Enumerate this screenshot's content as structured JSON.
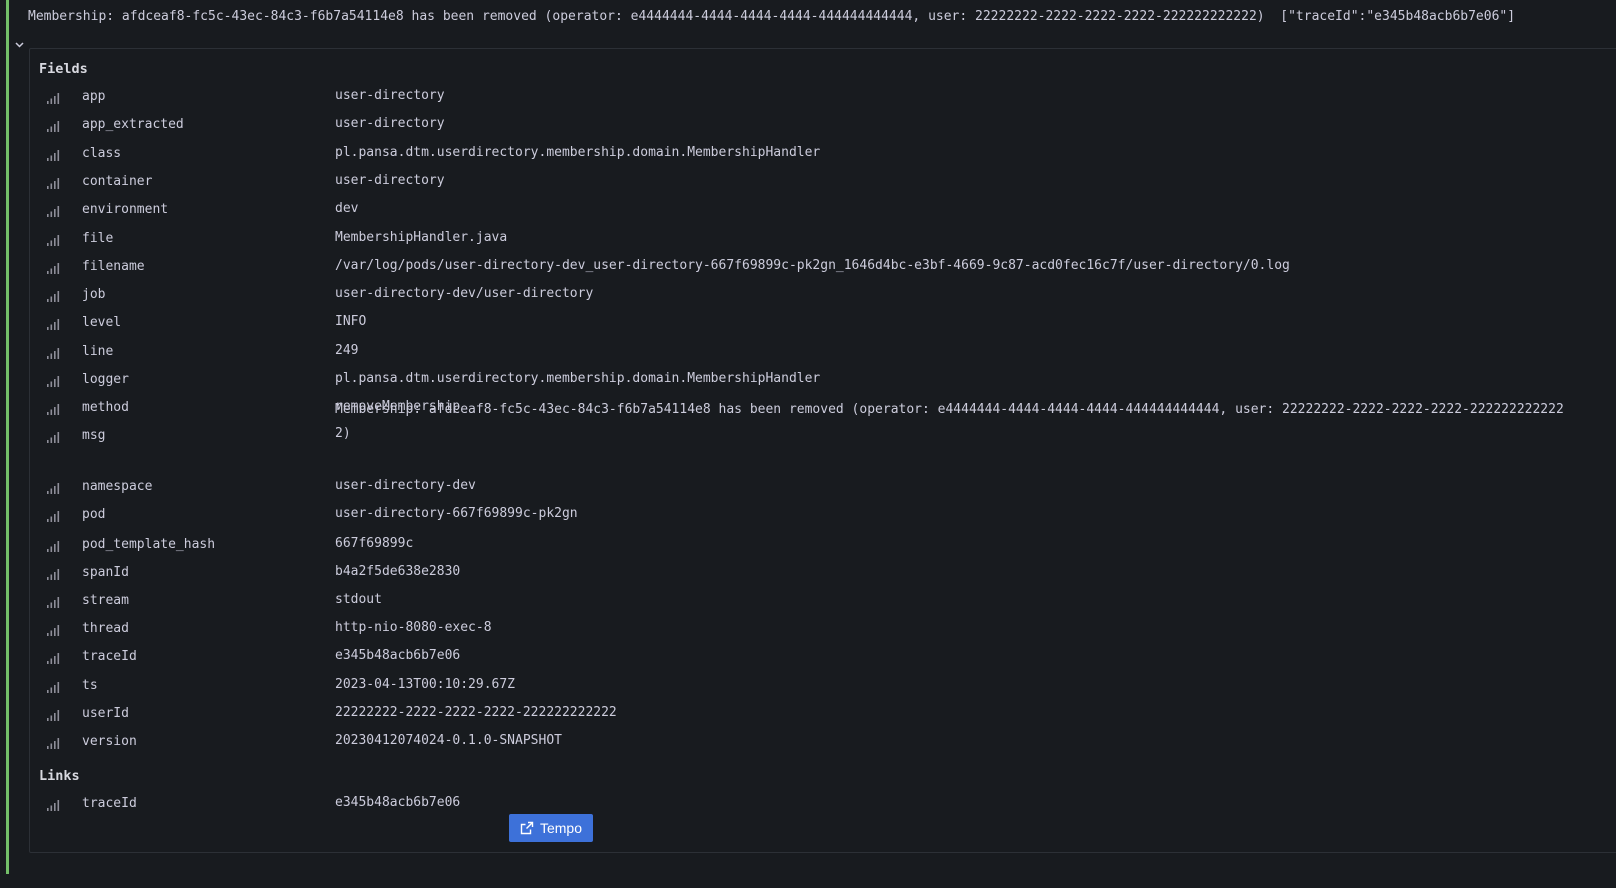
{
  "log_line": {
    "text": "Membership: afdceaf8-fc5c-43ec-84c3-f6b7a54114e8 has been removed (operator: e4444444-4444-4444-4444-444444444444, user: 22222222-2222-2222-2222-222222222222)  [\"traceId\":\"e345b48acb6b7e06\"]"
  },
  "sections": {
    "fields_title": "Fields",
    "links_title": "Links"
  },
  "fields": [
    {
      "key": "app",
      "value": "user-directory"
    },
    {
      "key": "app_extracted",
      "value": "user-directory"
    },
    {
      "key": "class",
      "value": "pl.pansa.dtm.userdirectory.membership.domain.MembershipHandler"
    },
    {
      "key": "container",
      "value": "user-directory"
    },
    {
      "key": "environment",
      "value": "dev"
    },
    {
      "key": "file",
      "value": "MembershipHandler.java"
    },
    {
      "key": "filename",
      "value": "/var/log/pods/user-directory-dev_user-directory-667f69899c-pk2gn_1646d4bc-e3bf-4669-9c87-acd0fec16c7f/user-directory/0.log"
    },
    {
      "key": "job",
      "value": "user-directory-dev/user-directory"
    },
    {
      "key": "level",
      "value": "INFO"
    },
    {
      "key": "line",
      "value": "249"
    },
    {
      "key": "logger",
      "value": "pl.pansa.dtm.userdirectory.membership.domain.MembershipHandler"
    },
    {
      "key": "method",
      "value": "removeMembership"
    },
    {
      "key": "msg",
      "value": "Membership: afdceaf8-fc5c-43ec-84c3-f6b7a54114e8 has been removed (operator: e4444444-4444-4444-4444-444444444444, user: 22222222-2222-2222-2222-222222222222\n2)"
    },
    {
      "key": "namespace",
      "value": "user-directory-dev"
    },
    {
      "key": "pod",
      "value": "user-directory-667f69899c-pk2gn"
    },
    {
      "key": "pod_template_hash",
      "value": "667f69899c"
    },
    {
      "key": "spanId",
      "value": "b4a2f5de638e2830"
    },
    {
      "key": "stream",
      "value": "stdout"
    },
    {
      "key": "thread",
      "value": "http-nio-8080-exec-8"
    },
    {
      "key": "traceId",
      "value": "e345b48acb6b7e06"
    },
    {
      "key": "ts",
      "value": "2023-04-13T00:10:29.67Z"
    },
    {
      "key": "userId",
      "value": "22222222-2222-2222-2222-222222222222"
    },
    {
      "key": "version",
      "value": "20230412074024-0.1.0-SNAPSHOT"
    }
  ],
  "links": [
    {
      "key": "traceId",
      "value": "e345b48acb6b7e06",
      "button_label": "Tempo"
    }
  ],
  "colors": {
    "background": "#181b1f",
    "level_bar": "#73bf69",
    "button": "#3d71d9",
    "text": "#ccccdc"
  }
}
